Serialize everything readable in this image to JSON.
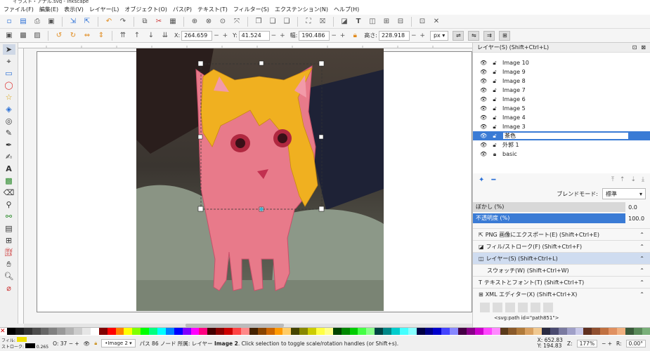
{
  "window": {
    "title": "イラスト・アナル.svg - Inkscape"
  },
  "menu": [
    "ファイル(F)",
    "編集(E)",
    "表示(V)",
    "レイヤー(L)",
    "オブジェクト(O)",
    "パス(P)",
    "テキスト(T)",
    "フィルター(S)",
    "エクステンション(N)",
    "ヘルプ(H)"
  ],
  "tool_controls": {
    "x_label": "X:",
    "x_value": "264.659",
    "y_label": "Y:",
    "y_value": "41.524",
    "w_label": "幅:",
    "w_value": "190.486",
    "h_label": "高さ:",
    "h_value": "228.918",
    "unit": "px"
  },
  "layers_panel": {
    "title": "レイヤー(S) (Shift+Ctrl+L)",
    "layers": [
      {
        "name": "Image 10"
      },
      {
        "name": "Image 9"
      },
      {
        "name": "Image 8"
      },
      {
        "name": "Image 7"
      },
      {
        "name": "Image 6"
      },
      {
        "name": "Image 5"
      },
      {
        "name": "Image 4"
      },
      {
        "name": "Image 3"
      },
      {
        "name": "茶色",
        "selected": true
      },
      {
        "name": "外郭 1"
      },
      {
        "name": "basic"
      }
    ],
    "blend_label": "ブレンドモード:",
    "blend_value": "標準",
    "blur_label": "ぼかし (%)",
    "blur_value": "0.0",
    "opacity_label": "不透明度 (%)",
    "opacity_value": "100.0"
  },
  "docks": [
    {
      "label": "PNG 画像にエクスポート(E) (Shift+Ctrl+E)",
      "icon": "export-icon"
    },
    {
      "label": "フィル/ストローク(F) (Shift+Ctrl+F)",
      "icon": "fill-stroke-icon"
    },
    {
      "label": "レイヤー(S) (Shift+Ctrl+L)",
      "icon": "layers-icon",
      "active": true
    },
    {
      "label": "スウォッチ(W) (Shift+Ctrl+W)",
      "icon": ""
    },
    {
      "label": "テキストとフォント(T) (Shift+Ctrl+T)",
      "icon": "text-icon"
    },
    {
      "label": "XML エディター(X) (Shift+Ctrl+X)",
      "icon": "xml-icon"
    }
  ],
  "xml_node": "<svg:path id=\"path851\">",
  "status": {
    "fill_label": "フィル:",
    "stroke_label": "ストローク:",
    "stroke_width": "0.265",
    "opacity_label": "O:",
    "opacity_value": "37",
    "layer_select": "•Image 2",
    "message_prefix": "パス 86 ノード 所属: レイヤー ",
    "message_layer": "Image 2",
    "message_suffix": ". Click selection to toggle scale/rotation handles (or Shift+s).",
    "x_label": "X:",
    "x_value": "652.83",
    "y_label": "Y:",
    "y_value": "194.83",
    "z_label": "Z:",
    "zoom": "177%",
    "r_label": "R:",
    "rotation": "0.00°"
  },
  "colors": {
    "selection": "#3a7bd5",
    "pink_fill": "#e87a8a",
    "orange_fill": "#f0b020"
  }
}
